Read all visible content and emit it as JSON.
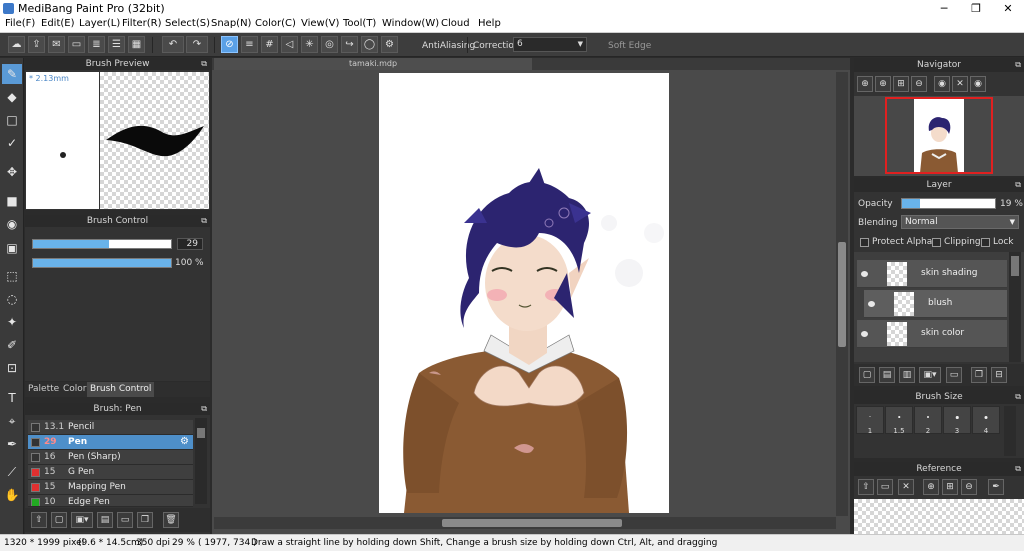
{
  "window": {
    "title": "MediBang Paint Pro (32bit)",
    "minimize": "─",
    "restore": "❐",
    "close": "✕"
  },
  "menu": [
    "File(F)",
    "Edit(E)",
    "Layer(L)",
    "Filter(R)",
    "Select(S)",
    "Snap(N)",
    "Color(C)",
    "View(V)",
    "Tool(T)",
    "Window(W)",
    "Cloud",
    "Help"
  ],
  "toolbar": {
    "antialiasing_label": "AntiAliasing",
    "antialiasing_checked": true,
    "correction_label": "Correction",
    "correction_value": "6",
    "soft_edge_label": "Soft Edge",
    "soft_edge_checked": false
  },
  "brush_preview": {
    "title": "Brush Preview",
    "size_label": "* 2.13mm"
  },
  "brush_control": {
    "title": "Brush Control",
    "size_value": "29",
    "size_fraction": 0.55,
    "opacity_value": "100 %",
    "opacity_fraction": 1.0
  },
  "panel_tabs": [
    "Palette",
    "Color",
    "Brush Control"
  ],
  "active_panel_tab": "Brush Control",
  "brush_list": {
    "title": "Brush: Pen",
    "items": [
      {
        "size": "13.1",
        "name": "Pencil",
        "color": "#333333",
        "selected": false
      },
      {
        "size": "29",
        "name": "Pen",
        "color": "#333333",
        "selected": true
      },
      {
        "size": "16",
        "name": "Pen (Sharp)",
        "color": "#333333",
        "selected": false
      },
      {
        "size": "15",
        "name": "G Pen",
        "color": "#e03030",
        "selected": false
      },
      {
        "size": "15",
        "name": "Mapping Pen",
        "color": "#e03030",
        "selected": false
      },
      {
        "size": "10",
        "name": "Edge Pen",
        "color": "#22aa22",
        "selected": false
      }
    ]
  },
  "canvas": {
    "tab_title": "tamaki.mdp"
  },
  "navigator": {
    "title": "Navigator"
  },
  "layer": {
    "title": "Layer",
    "opacity_label": "Opacity",
    "opacity_value": "19 %",
    "opacity_fraction": 0.19,
    "blending_label": "Blending",
    "blending_value": "Normal",
    "protect_alpha_label": "Protect Alpha",
    "clipping_label": "Clipping",
    "lock_label": "Lock",
    "items": [
      {
        "name": "skin shading",
        "clipped": false
      },
      {
        "name": "blush",
        "clipped": true
      },
      {
        "name": "skin color",
        "clipped": false
      }
    ]
  },
  "brush_size": {
    "title": "Brush Size",
    "sizes": [
      "1",
      "1.5",
      "2",
      "3",
      "4"
    ]
  },
  "reference": {
    "title": "Reference"
  },
  "status": {
    "dimensions": "1320 * 1999 pixel",
    "physical": "(9.6 * 14.5cm)",
    "dpi": "350 dpi",
    "zoom": "29 %",
    "coords": "( 1977, 734 )",
    "hint": "Draw a straight line by holding down Shift, Change a brush size by holding down Ctrl, Alt, and dragging"
  }
}
